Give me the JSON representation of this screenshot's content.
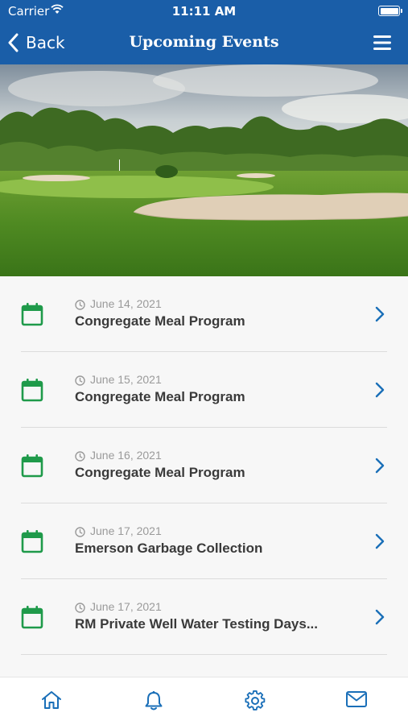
{
  "status": {
    "carrier": "Carrier",
    "time": "11:11 AM"
  },
  "header": {
    "back_label": "Back",
    "title": "Upcoming Events"
  },
  "events": [
    {
      "date": "June 14, 2021",
      "name": "Congregate Meal Program"
    },
    {
      "date": "June 15, 2021",
      "name": "Congregate Meal Program"
    },
    {
      "date": "June 16, 2021",
      "name": "Congregate Meal Program"
    },
    {
      "date": "June 17, 2021",
      "name": "Emerson Garbage Collection"
    },
    {
      "date": "June 17, 2021",
      "name": "RM Private Well Water Testing Days..."
    }
  ],
  "tabs": [
    "home-icon",
    "bell-icon",
    "gear-icon",
    "mail-icon"
  ],
  "colors": {
    "header": "#1a5ea8",
    "accent_green": "#1f9a4a",
    "accent_blue": "#1a6fb8"
  }
}
